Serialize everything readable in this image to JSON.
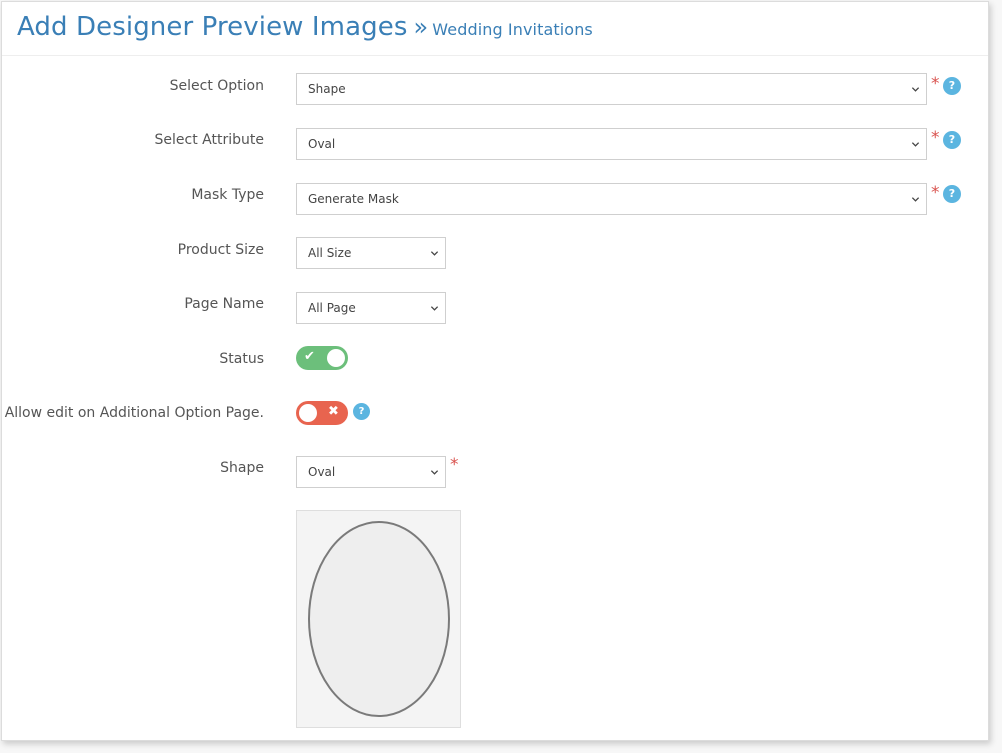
{
  "header": {
    "title": "Add Designer Preview Images",
    "separator": "»",
    "subtitle": "Wedding Invitations"
  },
  "form": {
    "select_option": {
      "label": "Select Option",
      "value": "Shape"
    },
    "select_attribute": {
      "label": "Select Attribute",
      "value": "Oval"
    },
    "mask_type": {
      "label": "Mask Type",
      "value": "Generate Mask"
    },
    "product_size": {
      "label": "Product Size",
      "value": "All Size"
    },
    "page_name": {
      "label": "Page Name",
      "value": "All Page"
    },
    "status": {
      "label": "Status",
      "enabled": true
    },
    "allow_edit": {
      "label": "Allow edit on Additional Option Page.",
      "enabled": false
    },
    "shape": {
      "label": "Shape",
      "value": "Oval"
    }
  },
  "required_marker": "*",
  "help_text": "?",
  "icons": {
    "dropdown": "chevron-down-icon",
    "help": "question-circle-icon",
    "toggle_on": "check-icon",
    "toggle_off": "close-icon"
  },
  "colors": {
    "title": "#3a7fb6",
    "required": "#d9534f",
    "help": "#5bb5e0",
    "toggle_on": "#6cbf7b",
    "toggle_off": "#e8644f"
  }
}
